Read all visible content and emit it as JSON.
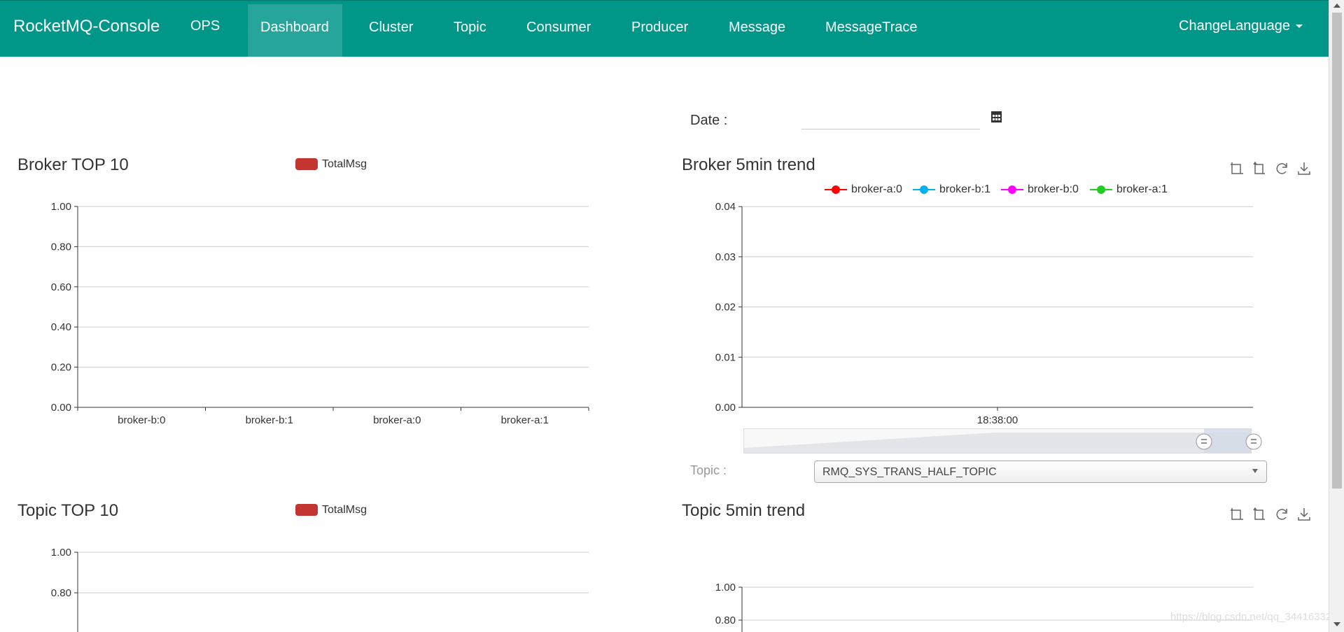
{
  "nav": {
    "brand": "RocketMQ-Console",
    "items": [
      {
        "label": "OPS"
      },
      {
        "label": "Dashboard"
      },
      {
        "label": "Cluster"
      },
      {
        "label": "Topic"
      },
      {
        "label": "Consumer"
      },
      {
        "label": "Producer"
      },
      {
        "label": "Message"
      },
      {
        "label": "MessageTrace"
      }
    ],
    "active": "Dashboard",
    "language": "ChangeLanguage"
  },
  "date": {
    "label": "Date :",
    "value": ""
  },
  "topic_select": {
    "label": "Topic :",
    "value": "RMQ_SYS_TRANS_HALF_TOPIC"
  },
  "colors": {
    "nav_bg": "#009688",
    "nav_active": "#26a69a",
    "bar": "#c23531"
  },
  "icons": [
    "calendar-icon",
    "zoom-icon",
    "zoom-reset-icon",
    "refresh-icon",
    "download-icon"
  ],
  "watermark": "https://blog.csdn.net/qq_34416332",
  "chart_data": [
    {
      "type": "bar",
      "title": "Broker TOP 10",
      "legend": [
        "TotalMsg"
      ],
      "categories": [
        "broker-b:0",
        "broker-b:1",
        "broker-a:0",
        "broker-a:1"
      ],
      "values": [
        0,
        0,
        0,
        0
      ],
      "yticks": [
        "0.00",
        "0.20",
        "0.40",
        "0.60",
        "0.80",
        "1.00"
      ],
      "ylim": [
        0,
        1
      ],
      "grid": true
    },
    {
      "type": "line",
      "title": "Broker 5min trend",
      "legend": [
        "broker-a:0",
        "broker-b:1",
        "broker-b:0",
        "broker-a:1"
      ],
      "legend_colors": [
        "#ff0000",
        "#00b0f0",
        "#ff00ff",
        "#22cc22"
      ],
      "x": [
        "18:38:00"
      ],
      "yticks": [
        "0.00",
        "0.01",
        "0.02",
        "0.03",
        "0.04"
      ],
      "ylim": [
        0,
        0.04
      ],
      "grid": true,
      "series": []
    },
    {
      "type": "bar",
      "title": "Topic TOP 10",
      "legend": [
        "TotalMsg"
      ],
      "yticks": [
        "0.80",
        "1.00"
      ],
      "ylim": [
        0,
        1
      ],
      "grid": true
    },
    {
      "type": "line",
      "title": "Topic 5min trend",
      "yticks": [
        "0.80",
        "1.00"
      ],
      "ylim": [
        0,
        1
      ],
      "grid": true
    }
  ]
}
